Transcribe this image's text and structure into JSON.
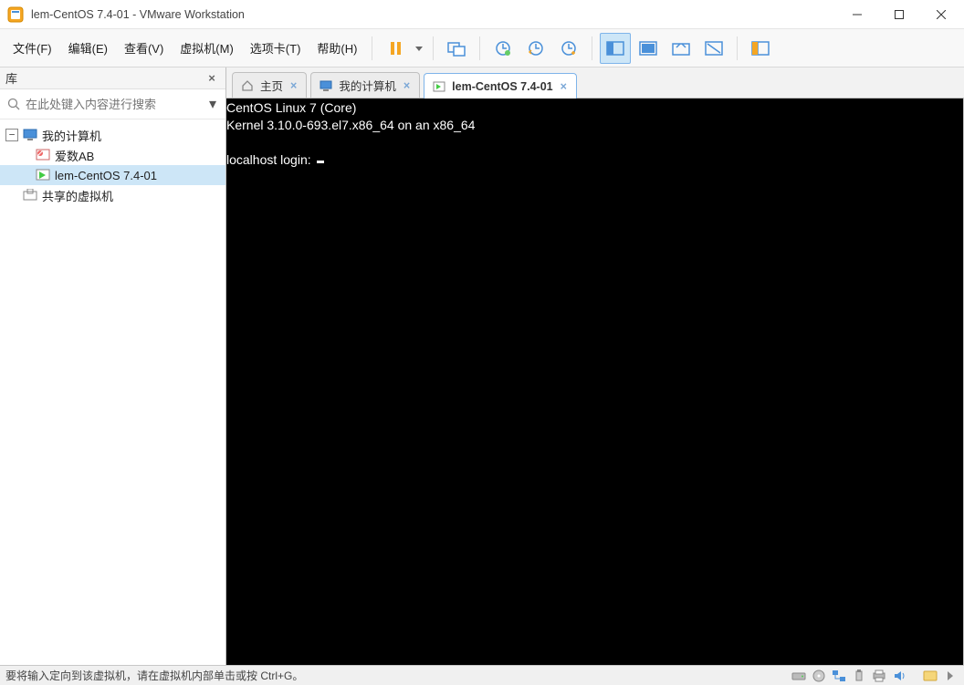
{
  "window": {
    "title": "lem-CentOS 7.4-01 - VMware Workstation"
  },
  "menu": {
    "file": "文件(F)",
    "edit": "编辑(E)",
    "view": "查看(V)",
    "vm": "虚拟机(M)",
    "tabs": "选项卡(T)",
    "help": "帮助(H)"
  },
  "sidebar": {
    "title": "库",
    "search_placeholder": "在此处键入内容进行搜索",
    "nodes": {
      "my_computer": "我的计算机",
      "item1": "爱数AB",
      "item2": "lem-CentOS 7.4-01",
      "shared": "共享的虚拟机"
    }
  },
  "tabs": {
    "home": "主页",
    "my_computer": "我的计算机",
    "vm": "lem-CentOS 7.4-01"
  },
  "terminal": {
    "line1": "CentOS Linux 7 (Core)",
    "line2": "Kernel 3.10.0-693.el7.x86_64 on an x86_64",
    "blank": "",
    "prompt": "localhost login: "
  },
  "statusbar": {
    "text": "要将输入定向到该虚拟机，请在虚拟机内部单击或按 Ctrl+G。"
  }
}
